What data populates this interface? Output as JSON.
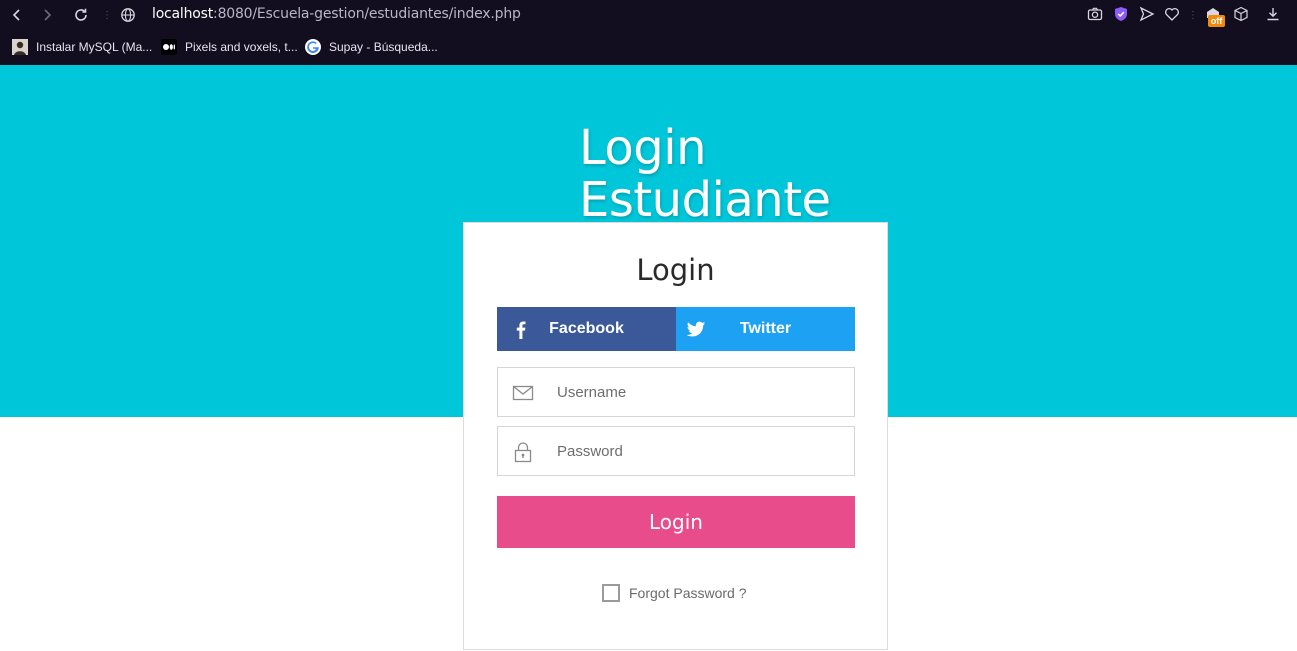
{
  "browser": {
    "url_host": "localhost",
    "url_rest": ":8080/Escuela-gestion/estudiantes/index.php",
    "extension_badge": "off",
    "bookmarks": [
      {
        "label": "Instalar MySQL (Ma...",
        "icon": "person-avatar-icon"
      },
      {
        "label": "Pixels and voxels, t...",
        "icon": "medium-icon"
      },
      {
        "label": "Supay - Búsqueda...",
        "icon": "google-icon"
      }
    ]
  },
  "hero": {
    "title_line1": "Login",
    "title_line2": "Estudiante"
  },
  "card": {
    "title": "Login",
    "facebook_label": "Facebook",
    "twitter_label": "Twitter",
    "username_placeholder": "Username",
    "password_placeholder": "Password",
    "login_label": "Login",
    "forgot_label": "Forgot Password ?",
    "colors": {
      "hero": "#00c6d9",
      "facebook": "#3b5998",
      "twitter": "#1da1f2",
      "login": "#e84c8b"
    }
  }
}
